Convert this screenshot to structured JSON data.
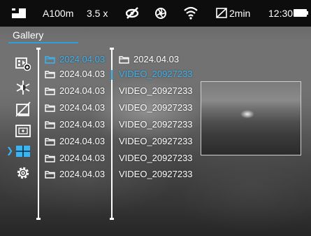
{
  "status": {
    "range": "A100m",
    "zoom": "3.5 x",
    "timer": "2min",
    "time": "12:30"
  },
  "gallery": {
    "title": "Gallery"
  },
  "menu": {
    "items": [
      {
        "icon": "video-record-icon"
      },
      {
        "icon": "palette-icon"
      },
      {
        "icon": "calibration-off-icon"
      },
      {
        "icon": "pip-icon"
      },
      {
        "icon": "gallery-icon",
        "selected": true
      },
      {
        "icon": "settings-icon"
      }
    ]
  },
  "folders": [
    {
      "label": "2024.04.03",
      "selected": true
    },
    {
      "label": "2024.04.03"
    },
    {
      "label": "2024.04.03"
    },
    {
      "label": "2024.04.03"
    },
    {
      "label": "2024.04.03"
    },
    {
      "label": "2024.04.03"
    },
    {
      "label": "2024.04.03"
    },
    {
      "label": "2024.04.03"
    }
  ],
  "files": {
    "folder": "2024.04.03",
    "items": [
      {
        "label": "VIDEO_20927233",
        "selected": true
      },
      {
        "label": "VIDEO_20927233"
      },
      {
        "label": "VIDEO_20927233"
      },
      {
        "label": "VIDEO_20927233"
      },
      {
        "label": "VIDEO_20927233"
      },
      {
        "label": "VIDEO_20927233"
      },
      {
        "label": "VIDEO_20927233"
      }
    ]
  },
  "colors": {
    "accent": "#3ab4f2",
    "statusbar": "#0d0d0d",
    "text": "#ffffff"
  }
}
